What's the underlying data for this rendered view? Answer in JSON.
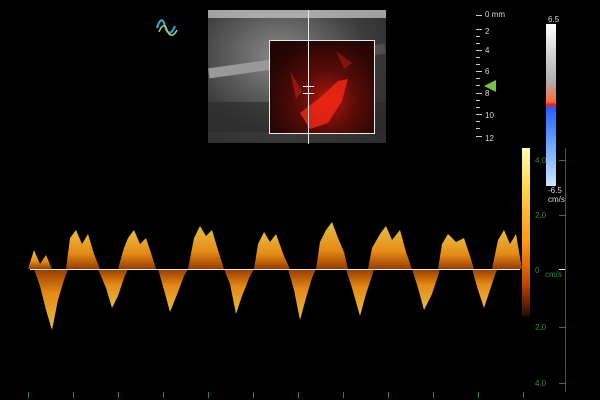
{
  "app": {
    "logo_icon": "wave-logo-icon"
  },
  "bmode": {
    "gate_marker": "sample-gate-icon"
  },
  "depth_scale": {
    "unit_label": "0 mm",
    "labels": [
      "2",
      "4",
      "6",
      "8",
      "10",
      "12"
    ],
    "focus_marker": "focus-arrow-icon"
  },
  "color_scale": {
    "top_value": "6.5",
    "bottom_value": "-6.5",
    "unit": "cm/s"
  },
  "spectral": {
    "velocity_labels": [
      "4.0",
      "2.0",
      "2.0",
      "4.0"
    ],
    "unit": "cm/s",
    "baseline_value": "0"
  },
  "colors": {
    "background": "#000000",
    "doppler_orange": "#ffa21a",
    "scale_green": "#2f8f2f",
    "focus_green": "#7ac143"
  }
}
